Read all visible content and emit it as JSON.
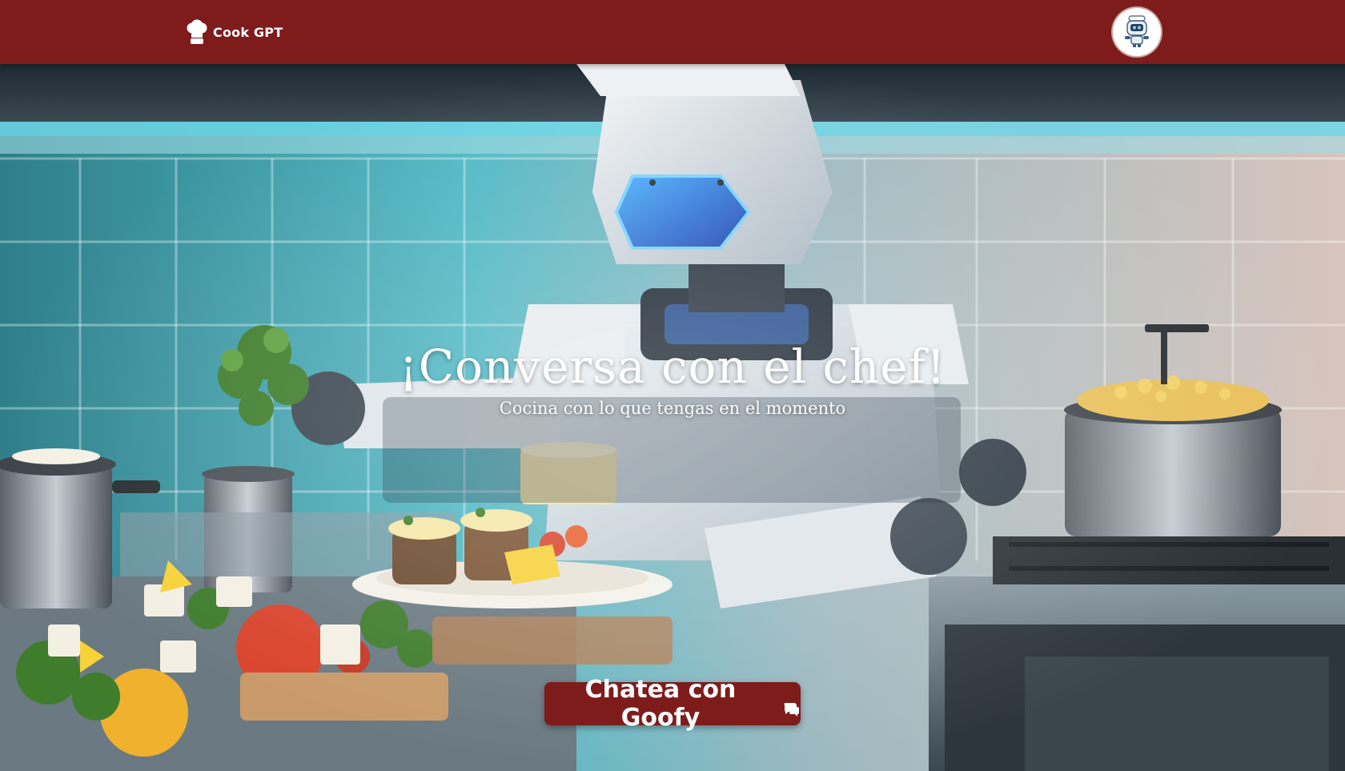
{
  "navbar": {
    "brand_label": "Cook GPT",
    "brand_icon": "chef-hat-icon",
    "avatar_icon": "robot-avatar-icon",
    "background_color": "#7e1c1c"
  },
  "hero": {
    "background_image": "robot-chef-kitchen",
    "title": "¡Conversa con el chef!",
    "subtitle": "Cocina con lo que tengas en el momento",
    "cta_label": "Chatea con Goofy",
    "cta_icon": "chat-bubbles-icon",
    "cta_color": "#7e1c1c"
  }
}
